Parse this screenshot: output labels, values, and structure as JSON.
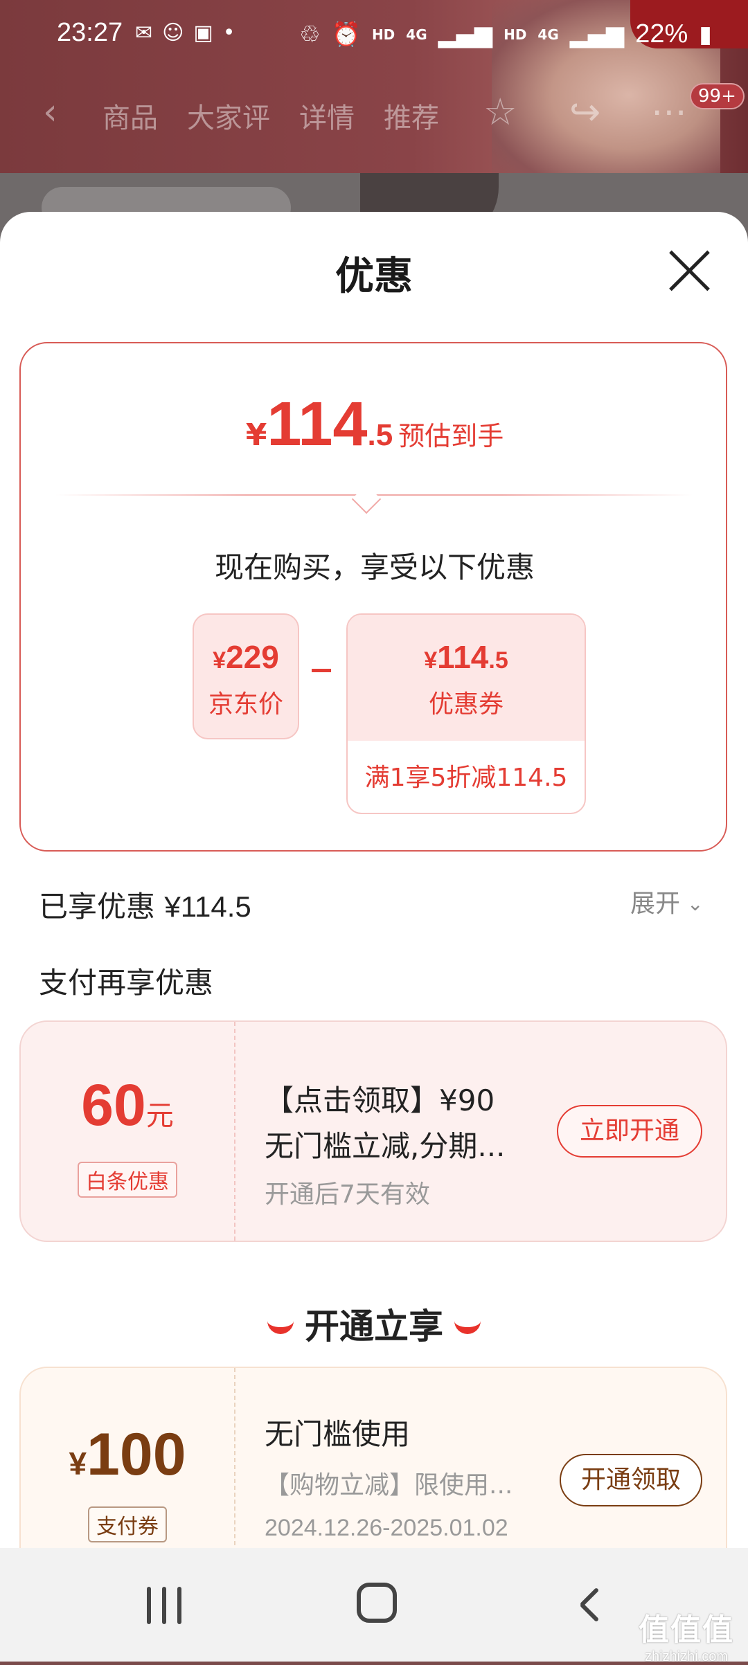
{
  "status_bar": {
    "time": "23:27",
    "hd1": "HD",
    "net1": "4G",
    "hd2": "HD",
    "net2": "4G",
    "battery": "22%"
  },
  "product_nav": {
    "tabs": [
      "商品",
      "大家评",
      "详情",
      "推荐"
    ],
    "badge": "99+"
  },
  "sheet": {
    "title": "优惠",
    "estimate": {
      "currency": "¥",
      "integer": "114",
      "decimal": ".5",
      "label": "预估到手"
    },
    "now_buy_text": "现在购买，享受以下优惠",
    "jd_price": {
      "currency": "¥",
      "value": "229",
      "label": "京东价"
    },
    "coupon": {
      "currency": "¥",
      "integer": "114",
      "decimal": ".5",
      "label": "优惠券",
      "rule": "满1享5折减114.5"
    },
    "enjoyed": {
      "label": "已享优惠",
      "amount": "¥114.5"
    },
    "expand_label": "展开",
    "pay_more_title": "支付再享优惠",
    "baitiao_card": {
      "amount": "60",
      "unit": "元",
      "tag": "白条优惠",
      "line1": "【点击领取】¥90",
      "line2": "无门槛立减,分期...",
      "line3": "开通后7天有效",
      "button": "立即开通"
    },
    "open_enjoy_title": "开通立享",
    "pay_coupon_card": {
      "currency": "¥",
      "amount": "100",
      "tag": "支付券",
      "line1": "无门槛使用",
      "line2": "【购物立减】限使用...",
      "line3": "2024.12.26-2025.01.02",
      "button": "开通领取"
    }
  },
  "watermark": {
    "text": "值值值",
    "url": "zhizhizhi.com"
  }
}
